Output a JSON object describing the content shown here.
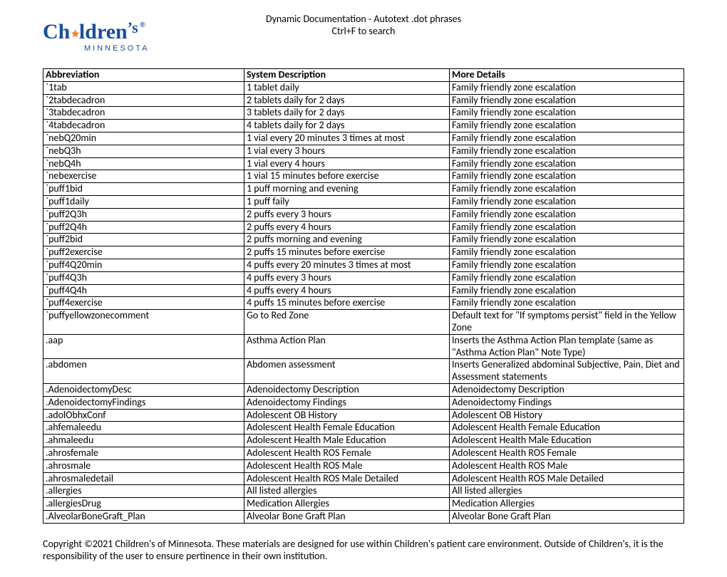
{
  "header": {
    "title1": "Dynamic Documentation - Autotext .dot phrases",
    "title2": "Ctrl+F to search",
    "logo_main": "Children",
    "logo_apos": "’s",
    "logo_reg": "®",
    "logo_sub": "MINNESOTA"
  },
  "table": {
    "columns": [
      "Abbreviation",
      "System Description",
      "More Details"
    ],
    "rows": [
      [
        "`1tab",
        "1 tablet daily",
        "Family friendly zone escalation"
      ],
      [
        "`2tabdecadron",
        "2 tablets daily for 2 days",
        "Family friendly zone escalation"
      ],
      [
        "`3tabdecadron",
        "3 tablets daily for 2 days",
        "Family friendly zone escalation"
      ],
      [
        "`4tabdecadron",
        "4 tablets daily for 2 days",
        "Family friendly zone escalation"
      ],
      [
        "`nebQ20min",
        "1 vial every 20 minutes 3 times at most",
        "Family friendly zone escalation"
      ],
      [
        "`nebQ3h",
        "1 vial every 3 hours",
        "Family friendly zone escalation"
      ],
      [
        "`nebQ4h",
        "1 vial every 4 hours",
        "Family friendly zone escalation"
      ],
      [
        "`nebexercise",
        "1 vial 15 minutes before exercise",
        "Family friendly zone escalation"
      ],
      [
        "`puff1bid",
        "1 puff morning and evening",
        "Family friendly zone escalation"
      ],
      [
        "`puff1daily",
        "1 puff faily",
        "Family friendly zone escalation"
      ],
      [
        "`puff2Q3h",
        "2 puffs every 3 hours",
        "Family friendly zone escalation"
      ],
      [
        "`puff2Q4h",
        "2 puffs every 4 hours",
        "Family friendly zone escalation"
      ],
      [
        "`puff2bid",
        "2 puffs morning and evening",
        "Family friendly zone escalation"
      ],
      [
        "`puff2exercise",
        "2 puffs 15 minutes before exercise",
        "Family friendly zone escalation"
      ],
      [
        "`puff4Q20min",
        "4 puffs every 20 minutes 3 times at most",
        "Family friendly zone escalation"
      ],
      [
        "`puff4Q3h",
        "4 puffs every 3 hours",
        "Family friendly zone escalation"
      ],
      [
        "`puff4Q4h",
        "4 puffs every 4 hours",
        "Family friendly zone escalation"
      ],
      [
        "`puff4exercise",
        "4 puffs 15 minutes before exercise",
        "Family friendly zone escalation"
      ],
      [
        "`puffyellowzonecomment",
        "Go to Red Zone",
        "Default text for \"If symptoms persist\" field in the Yellow Zone"
      ],
      [
        ".aap",
        "Asthma Action Plan",
        "Inserts the Asthma Action Plan template (same as  \"Asthma Action Plan\" Note Type)"
      ],
      [
        ".abdomen",
        "Abdomen assessment",
        "Inserts Generalized abdominal Subjective, Pain, Diet and Assessment statements"
      ],
      [
        ".AdenoidectomyDesc",
        "Adenoidectomy Description",
        "Adenoidectomy Description"
      ],
      [
        ".AdenoidectomyFindings",
        "Adenoidectomy Findings",
        "Adenoidectomy Findings"
      ],
      [
        ".adolObhxConf",
        "Adolescent OB History",
        "Adolescent OB History"
      ],
      [
        ".ahfemaleedu",
        "Adolescent Health Female Education",
        "Adolescent Health Female Education"
      ],
      [
        ".ahmaleedu",
        "Adolescent Health Male Education",
        "Adolescent Health Male Education"
      ],
      [
        ".ahrosfemale",
        "Adolescent Health ROS Female",
        "Adolescent Health ROS Female"
      ],
      [
        ".ahrosmale",
        "Adolescent Health ROS Male",
        "Adolescent Health ROS Male"
      ],
      [
        ".ahrosmaledetail",
        "Adolescent Health ROS Male Detailed",
        "Adolescent Health ROS Male Detailed"
      ],
      [
        ".allergies",
        "All listed allergies",
        "All listed allergies"
      ],
      [
        ".allergiesDrug",
        "Medication Allergies",
        "Medication Allergies"
      ],
      [
        ".AlveolarBoneGraft_Plan",
        "Alveolar Bone Graft Plan",
        "Alveolar Bone Graft Plan"
      ]
    ]
  },
  "footer": {
    "text": "Copyright ©2021 Children's of Minnesota. These materials are designed for use within Children's patient care environment.  Outside of Children's, it is the responsibility of the user to ensure pertinence in their own institution."
  }
}
